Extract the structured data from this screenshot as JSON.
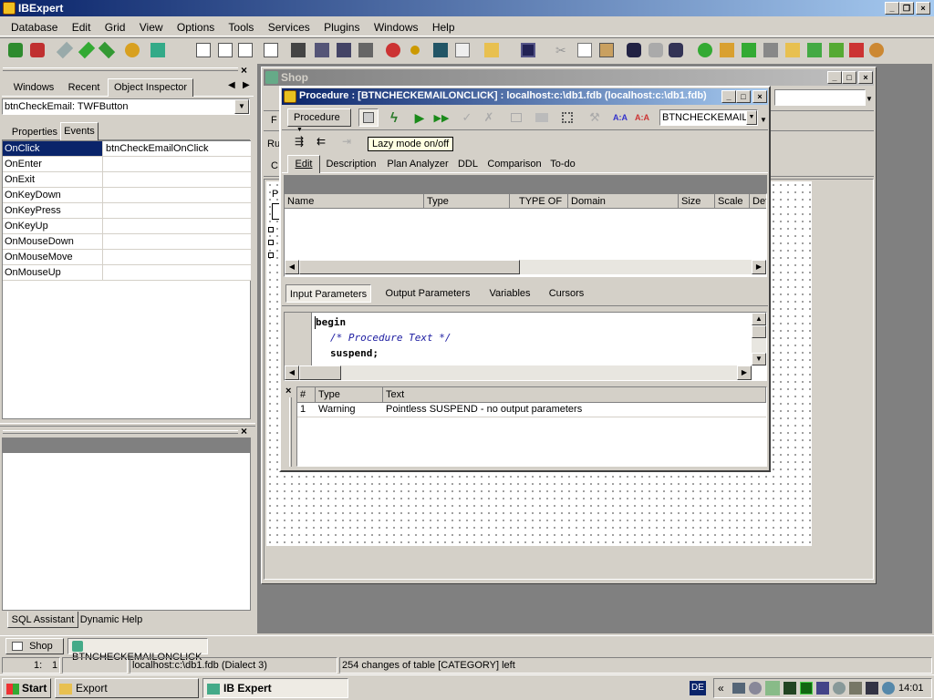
{
  "app": {
    "title": "IBExpert",
    "menu": [
      "Database",
      "Edit",
      "Grid",
      "View",
      "Options",
      "Tools",
      "Services",
      "Plugins",
      "Windows",
      "Help"
    ]
  },
  "inspector": {
    "tabs": [
      "Windows",
      "Recent",
      "Object Inspector"
    ],
    "component": "btnCheckEmail: TWFButton",
    "subtabs": [
      "Properties",
      "Events"
    ],
    "events": [
      {
        "name": "OnClick",
        "value": "btnCheckEmailOnClick"
      },
      {
        "name": "OnEnter",
        "value": ""
      },
      {
        "name": "OnExit",
        "value": ""
      },
      {
        "name": "OnKeyDown",
        "value": ""
      },
      {
        "name": "OnKeyPress",
        "value": ""
      },
      {
        "name": "OnKeyUp",
        "value": ""
      },
      {
        "name": "OnMouseDown",
        "value": ""
      },
      {
        "name": "OnMouseMove",
        "value": ""
      },
      {
        "name": "OnMouseUp",
        "value": ""
      }
    ],
    "bottom_tabs": [
      "SQL Assistant",
      "Dynamic Help"
    ]
  },
  "shop_window": {
    "title": "Shop",
    "side_letters": [
      "F",
      "Ru",
      "C",
      "P"
    ]
  },
  "procedure": {
    "title": "Procedure : [BTNCHECKEMAILONCLICK] : localhost:c:\\db1.fdb (localhost:c:\\db1.fdb)",
    "dropdown_label": "Procedure",
    "name_combo": "BTNCHECKEMAILO",
    "tooltip": "Lazy mode on/off",
    "tabs": [
      "Edit",
      "Description",
      "Plan Analyzer",
      "DDL",
      "Comparison",
      "To-do"
    ],
    "columns": [
      "Name",
      "Type",
      "TYPE OF",
      "Domain",
      "Size",
      "Scale",
      "Def"
    ],
    "param_tabs": [
      "Input Parameters",
      "Output Parameters",
      "Variables",
      "Cursors"
    ],
    "code": {
      "line1": "begin",
      "line2": "/* Procedure Text */",
      "line3": "suspend;"
    },
    "messages": {
      "headers": [
        "#",
        "Type",
        "Text"
      ],
      "rows": [
        {
          "num": "1",
          "type": "Warning",
          "text": "Pointless SUSPEND - no output parameters"
        }
      ]
    }
  },
  "taskbar_mdi": [
    "Shop",
    "BTNCHECKEMAILONCLICK"
  ],
  "statusbar": {
    "position": "1:",
    "col": "1",
    "db": "localhost:c:\\db1.fdb (Dialect 3)",
    "changes": "254 changes of table [CATEGORY] left"
  },
  "os_taskbar": {
    "start": "Start",
    "items": [
      "Export",
      "IB Expert"
    ],
    "lang": "DE",
    "clock": "14:01"
  },
  "colors": {
    "title_active": "#0a246a",
    "title_gradient": "#a6caf0",
    "title_inactive": "#808080",
    "selection": "#0a246a",
    "mdi_bg": "#808080"
  }
}
